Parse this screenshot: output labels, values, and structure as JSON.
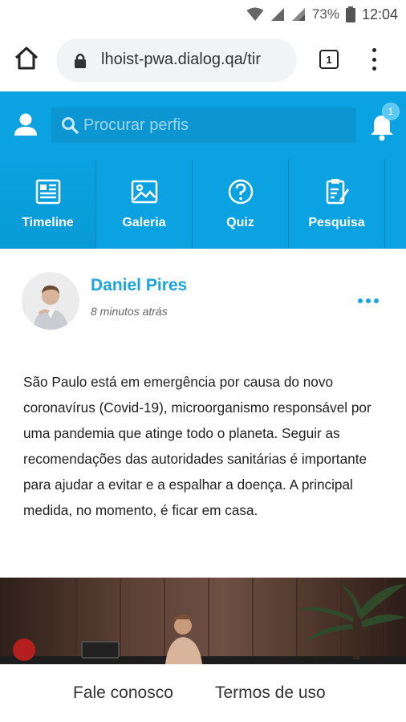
{
  "status_bar": {
    "battery": "73%",
    "time": "12:04"
  },
  "browser": {
    "url": "lhoist-pwa.dialog.qa/tir",
    "tab_count": "1"
  },
  "header": {
    "search_placeholder": "Procurar perfis",
    "notification_count": "1"
  },
  "nav": {
    "tabs": [
      {
        "label": "Timeline",
        "icon": "newspaper-icon"
      },
      {
        "label": "Galeria",
        "icon": "gallery-icon"
      },
      {
        "label": "Quiz",
        "icon": "question-icon"
      },
      {
        "label": "Pesquisa",
        "icon": "survey-icon"
      }
    ]
  },
  "post": {
    "author": "Daniel Pires",
    "time": "8 minutos atrás",
    "text": "São Paulo está em emergência por causa do novo coronavírus (Covid-19), microorganismo responsável por uma pandemia que atinge todo o planeta. Seguir as recomendações das autoridades sanitárias é importante para ajudar a evitar e a espalhar a doença. A principal medida, no momento, é ficar em casa."
  },
  "footer": {
    "contact": "Fale conosco",
    "terms": "Termos de uso"
  },
  "colors": {
    "brand": "#0aa2e0",
    "accent": "#1ba4dc"
  }
}
